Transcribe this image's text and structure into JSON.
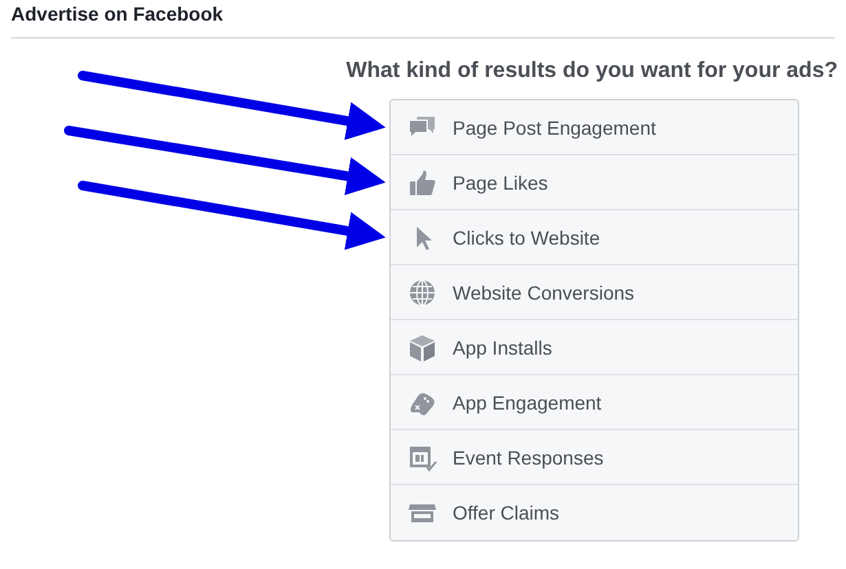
{
  "header": {
    "title": "Advertise on Facebook"
  },
  "question": "What kind of results do you want for your ads?",
  "objectives": [
    {
      "kind": "engagement",
      "label": "Page Post Engagement",
      "arrow": true
    },
    {
      "kind": "likes",
      "label": "Page Likes",
      "arrow": true
    },
    {
      "kind": "clicks",
      "label": "Clicks to Website",
      "arrow": true
    },
    {
      "kind": "conversions",
      "label": "Website Conversions",
      "arrow": false
    },
    {
      "kind": "installs",
      "label": "App Installs",
      "arrow": false
    },
    {
      "kind": "appengagement",
      "label": "App Engagement",
      "arrow": false
    },
    {
      "kind": "events",
      "label": "Event Responses",
      "arrow": false
    },
    {
      "kind": "offers",
      "label": "Offer Claims",
      "arrow": false
    }
  ]
}
